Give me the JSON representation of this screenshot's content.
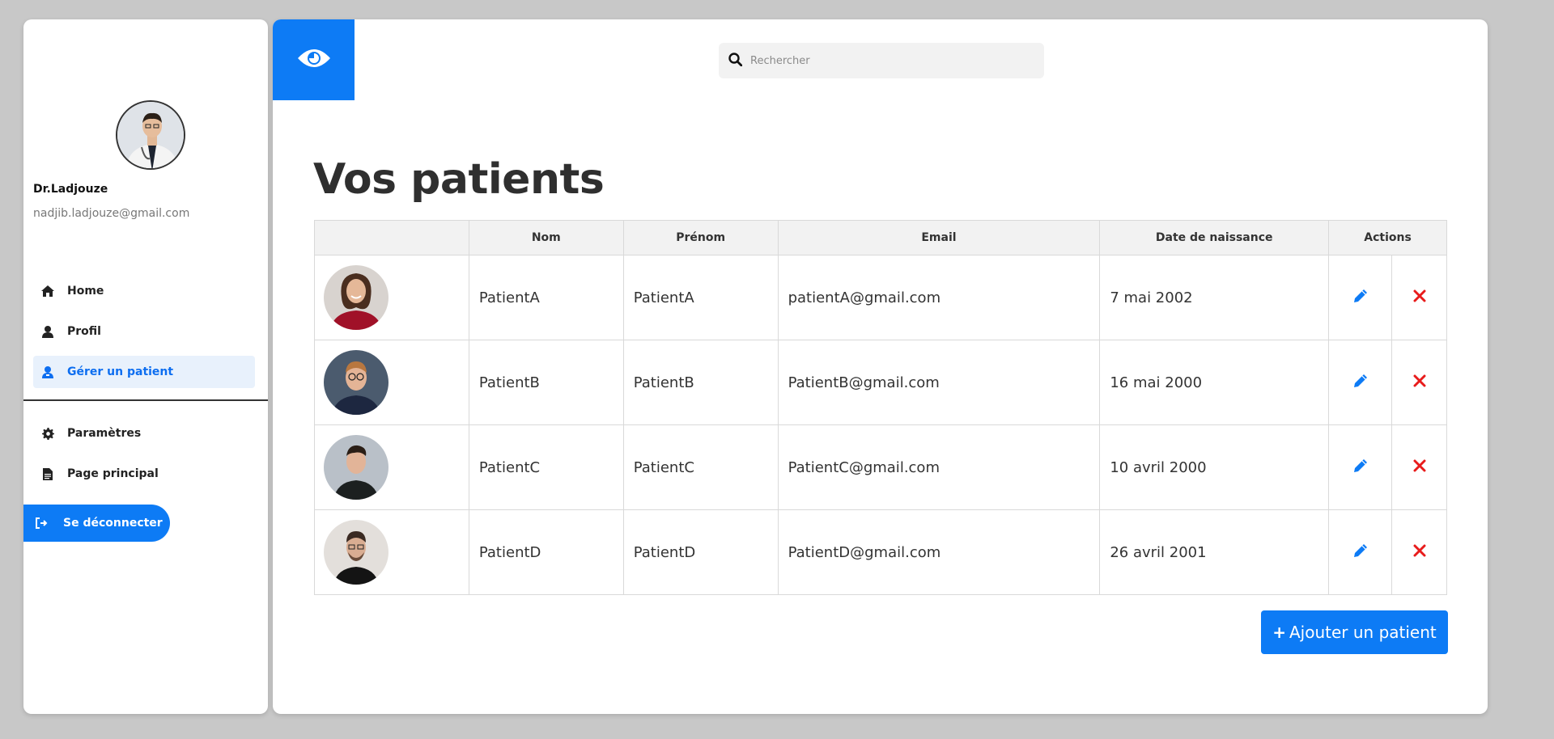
{
  "app": {
    "logo_icon": "eye-icon",
    "accent_color": "#0d7bf5",
    "danger_color": "#e81b1b"
  },
  "sidebar": {
    "doctor_name": "Dr.Ladjouze",
    "doctor_email": "nadjib.ladjouze@gmail.com",
    "items": [
      {
        "label": "Home",
        "icon": "home-icon"
      },
      {
        "label": "Profil",
        "icon": "user-icon"
      },
      {
        "label": "Gérer un patient",
        "icon": "user-manage-icon",
        "active": true
      }
    ],
    "items2": [
      {
        "label": "Paramètres",
        "icon": "gear-icon"
      },
      {
        "label": "Page principal",
        "icon": "file-icon"
      }
    ],
    "logout_label": "Se déconnecter"
  },
  "search": {
    "placeholder": "Rechercher"
  },
  "main": {
    "title": "Vos patients",
    "columns": [
      "",
      "Nom",
      "Prénom",
      "Email",
      "Date de naissance",
      "Actions"
    ],
    "rows": [
      {
        "nom": "PatientA",
        "prenom": "PatientA",
        "email": "patientA@gmail.com",
        "date": "7 mai 2002"
      },
      {
        "nom": "PatientB",
        "prenom": "PatientB",
        "email": "PatientB@gmail.com",
        "date": "16 mai 2000"
      },
      {
        "nom": "PatientC",
        "prenom": "PatientC",
        "email": "PatientC@gmail.com",
        "date": "10 avril 2000"
      },
      {
        "nom": "PatientD",
        "prenom": "PatientD",
        "email": "PatientD@gmail.com",
        "date": "26 avril 2001"
      }
    ],
    "add_button_label": "Ajouter un patient"
  }
}
